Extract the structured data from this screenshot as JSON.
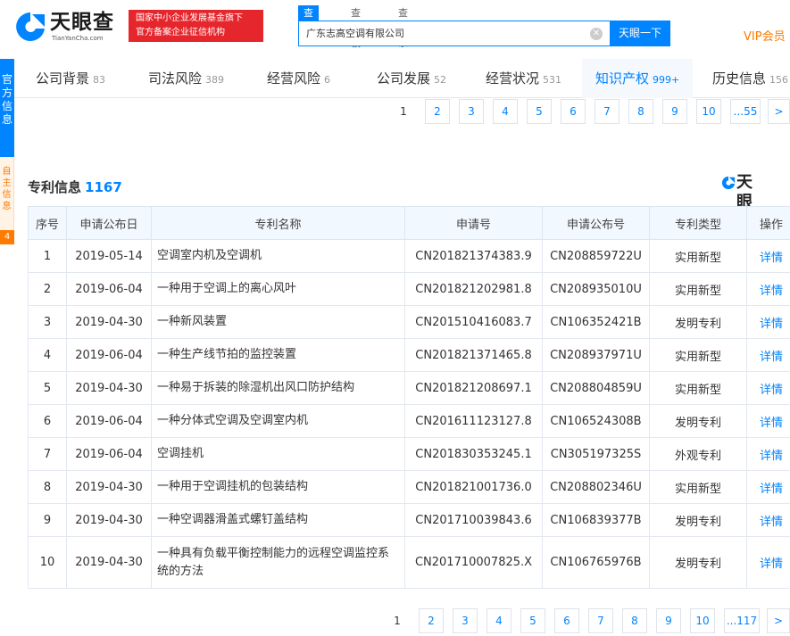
{
  "header": {
    "logo_text": "天眼查",
    "logo_sub": "TianYanCha.com",
    "badge_line1": "国家中小企业发展基金旗下",
    "badge_line2": "官方备案企业征信机构",
    "search_tabs": [
      "查公司",
      "查老板",
      "查关系"
    ],
    "search_value": "广东志高空调有限公司",
    "search_button": "天眼一下",
    "vip": "VIP会员"
  },
  "side": {
    "blue_text": "官方信息",
    "orange_text": "自主信息",
    "orange_tag": "4"
  },
  "nav": {
    "tabs": [
      {
        "label": "公司背景",
        "count": "83"
      },
      {
        "label": "司法风险",
        "count": "389"
      },
      {
        "label": "经营风险",
        "count": "6"
      },
      {
        "label": "公司发展",
        "count": "52"
      },
      {
        "label": "经营状况",
        "count": "531"
      },
      {
        "label": "知识产权",
        "count": "999+"
      },
      {
        "label": "历史信息",
        "count": "156"
      }
    ],
    "active": "知识产权"
  },
  "pager_top": [
    "1",
    "2",
    "3",
    "4",
    "5",
    "6",
    "7",
    "8",
    "9",
    "10",
    "...55",
    ">"
  ],
  "section": {
    "title": "专利信息",
    "count": "1167",
    "brand": "天眼查"
  },
  "table": {
    "headers": [
      "序号",
      "申请公布日",
      "专利名称",
      "申请号",
      "申请公布号",
      "专利类型",
      "操作"
    ],
    "rows": [
      [
        "1",
        "2019-05-14",
        "空调室内机及空调机",
        "CN201821374383.9",
        "CN208859722U",
        "实用新型",
        "详情"
      ],
      [
        "2",
        "2019-06-04",
        "一种用于空调上的离心风叶",
        "CN201821202981.8",
        "CN208935010U",
        "实用新型",
        "详情"
      ],
      [
        "3",
        "2019-04-30",
        "一种新风装置",
        "CN201510416083.7",
        "CN106352421B",
        "发明专利",
        "详情"
      ],
      [
        "4",
        "2019-06-04",
        "一种生产线节拍的监控装置",
        "CN201821371465.8",
        "CN208937971U",
        "实用新型",
        "详情"
      ],
      [
        "5",
        "2019-04-30",
        "一种易于拆装的除湿机出风口防护结构",
        "CN201821208697.1",
        "CN208804859U",
        "实用新型",
        "详情"
      ],
      [
        "6",
        "2019-06-04",
        "一种分体式空调及空调室内机",
        "CN201611123127.8",
        "CN106524308B",
        "发明专利",
        "详情"
      ],
      [
        "7",
        "2019-06-04",
        "空调挂机",
        "CN201830353245.1",
        "CN305197325S",
        "外观专利",
        "详情"
      ],
      [
        "8",
        "2019-04-30",
        "一种用于空调挂机的包装结构",
        "CN201821001736.0",
        "CN208802346U",
        "实用新型",
        "详情"
      ],
      [
        "9",
        "2019-04-30",
        "一种空调器滑盖式螺钉盖结构",
        "CN201710039843.6",
        "CN106839377B",
        "发明专利",
        "详情"
      ],
      [
        "10",
        "2019-04-30",
        "一种具有负载平衡控制能力的远程空调监控系统的方法",
        "CN201710007825.X",
        "CN106765976B",
        "发明专利",
        "详情"
      ]
    ]
  },
  "pager_bottom": [
    "1",
    "2",
    "3",
    "4",
    "5",
    "6",
    "7",
    "8",
    "9",
    "10",
    "...117",
    ">"
  ],
  "colors": {
    "accent": "#0084ff",
    "badge_red": "#e5262c",
    "vip_orange": "#ff7a00"
  }
}
